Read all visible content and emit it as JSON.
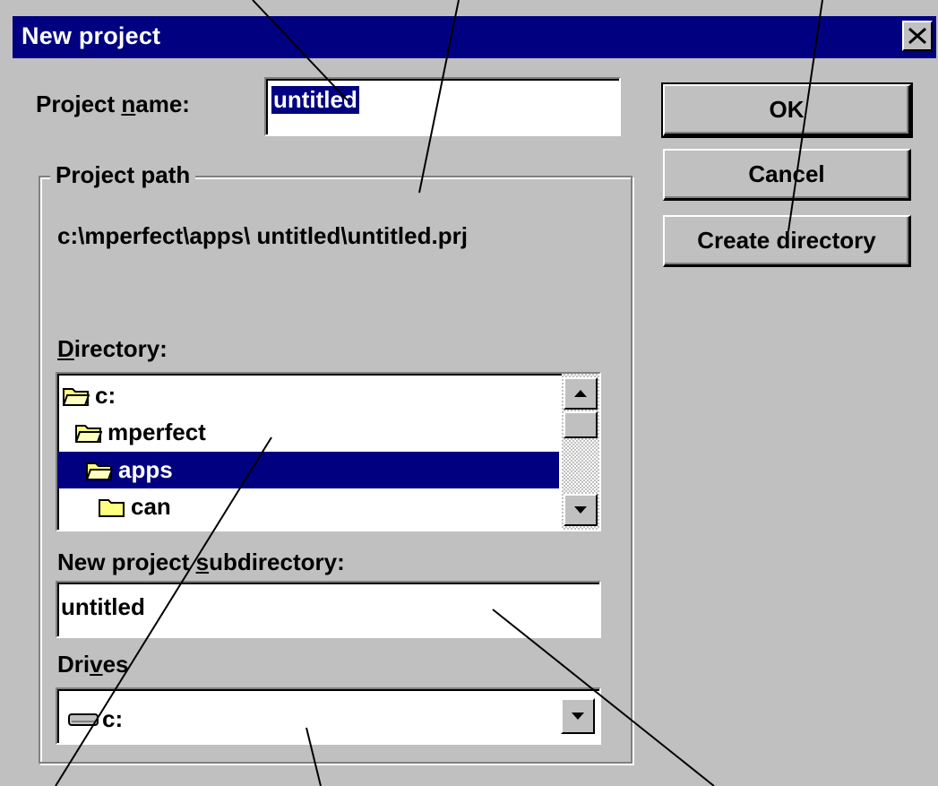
{
  "dialog": {
    "title": "New project",
    "close_label": "×"
  },
  "project_name": {
    "label_pre": "Project ",
    "label_accel": "n",
    "label_post": "ame:",
    "value": "untitled"
  },
  "buttons": {
    "ok": "OK",
    "cancel": "Cancel",
    "create_directory": "Create directory"
  },
  "project_path": {
    "group_label": "Project path",
    "path_value": "c:\\mperfect\\apps\\ untitled\\untitled.prj"
  },
  "directory": {
    "label_accel": "D",
    "label_post": "irectory:",
    "items": [
      {
        "label": "c:",
        "selected": false
      },
      {
        "label": "mperfect",
        "selected": false
      },
      {
        "label": "apps",
        "selected": true
      },
      {
        "label": "can",
        "selected": false
      }
    ]
  },
  "subdirectory": {
    "label_pre": "New project ",
    "label_accel": "s",
    "label_post": "ubdirectory:",
    "value": "untitled"
  },
  "drives": {
    "label_pre": "Dri",
    "label_accel": "v",
    "label_post": "es",
    "selected": "c:"
  },
  "colors": {
    "face": "#c0c0c0",
    "titlebar": "#000080",
    "selection": "#000080",
    "folder": "#ffff80"
  }
}
